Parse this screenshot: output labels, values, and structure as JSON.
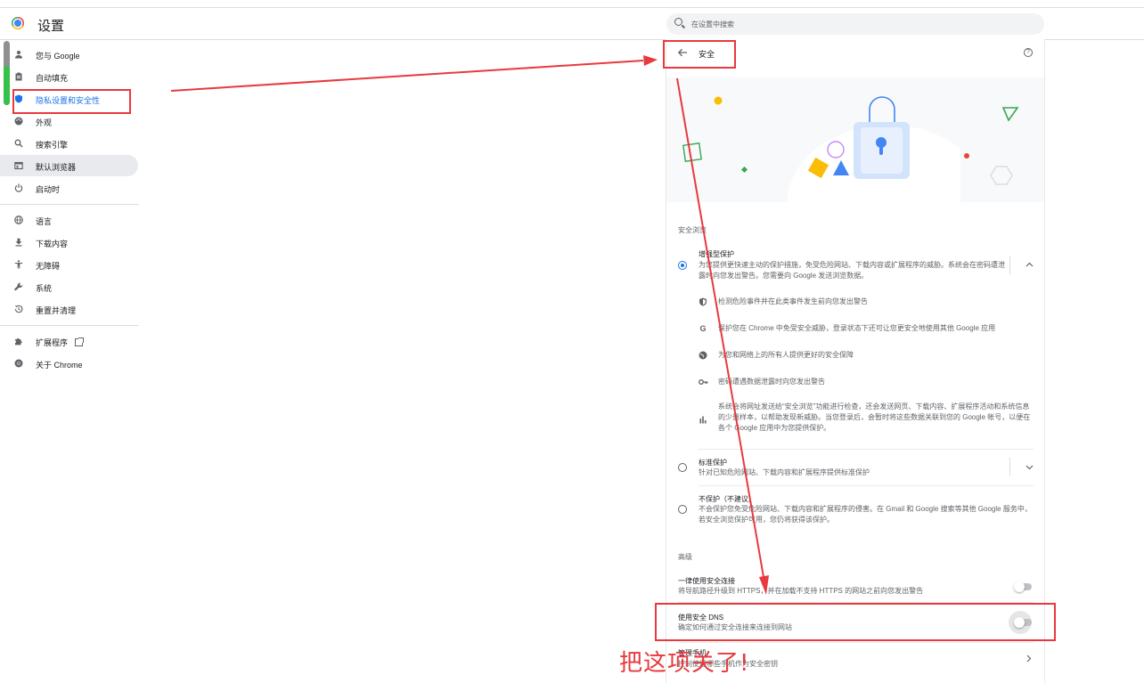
{
  "header": {
    "app_title": "设置",
    "search_placeholder": "在设置中搜索"
  },
  "sidebar": {
    "items": [
      {
        "label": "您与 Google",
        "icon": "person-icon"
      },
      {
        "label": "自动填充",
        "icon": "clipboard-icon"
      },
      {
        "label": "隐私设置和安全性",
        "icon": "shield-icon",
        "active": true
      },
      {
        "label": "外观",
        "icon": "palette-icon"
      },
      {
        "label": "搜索引擎",
        "icon": "search-icon"
      },
      {
        "label": "默认浏览器",
        "icon": "browser-icon"
      },
      {
        "label": "启动时",
        "icon": "power-icon"
      },
      {
        "label": "语言",
        "icon": "globe-icon"
      },
      {
        "label": "下载内容",
        "icon": "download-icon"
      },
      {
        "label": "无障碍",
        "icon": "accessibility-icon"
      },
      {
        "label": "系统",
        "icon": "wrench-icon"
      },
      {
        "label": "重置并清理",
        "icon": "restore-icon"
      },
      {
        "label": "扩展程序",
        "icon": "puzzle-icon"
      },
      {
        "label": "关于 Chrome",
        "icon": "chrome-icon"
      }
    ]
  },
  "panel": {
    "title": "安全",
    "section_safe_browsing": "安全浏览",
    "enhanced": {
      "title": "增强型保护",
      "desc": "为您提供更快速主动的保护措施，免受危险网站、下载内容或扩展程序的威胁。系统会在密码遭泄露时向您发出警告。您需要向 Google 发送浏览数据。",
      "selected": true
    },
    "features": [
      {
        "icon": "shield-icon",
        "text": "检测危险事件并在此类事件发生前向您发出警告"
      },
      {
        "icon": "google-g-icon",
        "text": "保护您在 Chrome 中免受安全威胁，登录状态下还可让您更安全地使用其他 Google 应用"
      },
      {
        "icon": "globe-icon",
        "text": "为您和网络上的所有人提供更好的安全保障"
      },
      {
        "icon": "key-icon",
        "text": "密码遭遇数据泄露时向您发出警告"
      },
      {
        "icon": "bar-chart-icon",
        "text": "系统会将网址发送给“安全浏览”功能进行检查，还会发送网页、下载内容、扩展程序活动和系统信息的少量样本，以帮助发现新威胁。当您登录后，会暂时将这些数据关联到您的 Google 帐号，以便在各个 Google 应用中为您提供保护。"
      }
    ],
    "standard": {
      "title": "标准保护",
      "desc": "针对已知危险网站、下载内容和扩展程序提供标准保护"
    },
    "noprotect": {
      "title": "不保护（不建议）",
      "desc": "不会保护您免受危险网站、下载内容和扩展程序的侵害。在 Gmail 和 Google 搜索等其他 Google 服务中，若安全浏览保护可用，您仍将获得该保护。"
    },
    "section_advanced": "高级",
    "https": {
      "title": "一律使用安全连接",
      "desc": "将导航路径升级到 HTTPS，并在加载不支持 HTTPS 的网站之前向您发出警告",
      "enabled": false
    },
    "dns": {
      "title": "使用安全 DNS",
      "desc": "确定如何通过安全连接来连接到网站",
      "enabled": false
    },
    "manage_keys": {
      "title": "管理手机",
      "desc": "控制使用哪些手机作为安全密钥"
    }
  },
  "annotation": {
    "text": "把这项关了!",
    "color": "#e8393e"
  },
  "colors": {
    "accent": "#1a73e8",
    "annotation_red": "#e8393e"
  }
}
